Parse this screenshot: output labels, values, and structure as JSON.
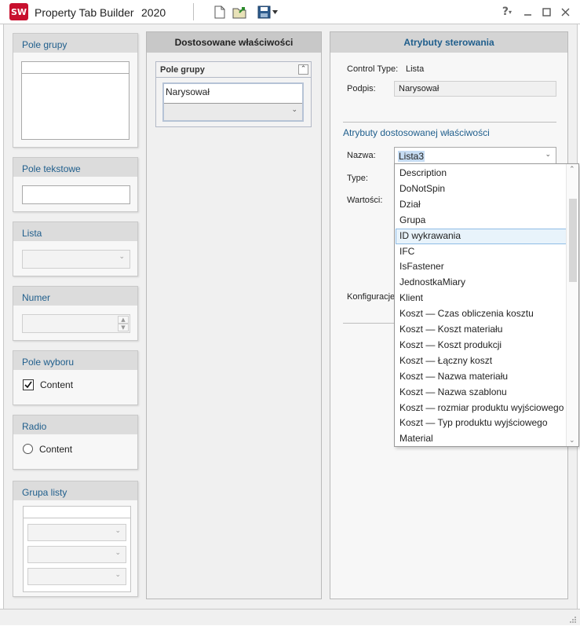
{
  "titlebar": {
    "app_icon_text": "SW",
    "title": "Property Tab Builder",
    "year": "2020",
    "help_label": "?"
  },
  "palette": {
    "group_box": {
      "title": "Pole grupy"
    },
    "text_field": {
      "title": "Pole tekstowe"
    },
    "list": {
      "title": "Lista"
    },
    "number": {
      "title": "Numer"
    },
    "checkbox": {
      "title": "Pole wyboru",
      "label": "Content",
      "checked": true
    },
    "radio": {
      "title": "Radio",
      "label": "Content",
      "checked": false
    },
    "list_group": {
      "title": "Grupa listy"
    }
  },
  "middle": {
    "header": "Dostosowane właściwości",
    "group": {
      "title": "Pole grupy",
      "field_label": "Narysował"
    }
  },
  "right": {
    "header": "Atrybuty sterowania",
    "control_type_label": "Control Type:",
    "control_type_value": "Lista",
    "caption_label": "Podpis:",
    "caption_value": "Narysował",
    "custom_section_title": "Atrybuty dostosowanej właściwości",
    "name_label": "Nazwa:",
    "name_value": "Lista3",
    "type_label": "Type:",
    "values_label": "Wartości:",
    "config_label": "Konfiguracje"
  },
  "dropdown": {
    "selected_index": 4,
    "options": [
      "Description",
      "DoNotSpin",
      "Dział",
      "Grupa",
      "ID wykrawania",
      "IFC",
      "IsFastener",
      "JednostkaMiary",
      "Klient",
      "Koszt — Czas obliczenia kosztu",
      "Koszt — Koszt materiału",
      "Koszt — Koszt produkcji",
      "Koszt — Łączny koszt",
      "Koszt — Nazwa materiału",
      "Koszt — Nazwa szablonu",
      "Koszt — rozmiar produktu wyjściowego",
      "Koszt — Typ produktu wyjściowego",
      "Material"
    ]
  },
  "colors": {
    "accent_blue": "#1f5e8c",
    "selection_bg": "#e8f3fb",
    "brand_red": "#c8102e"
  }
}
